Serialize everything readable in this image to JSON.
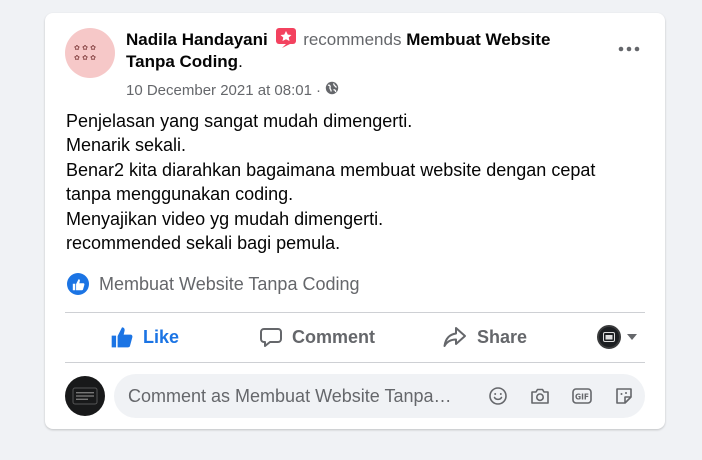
{
  "post": {
    "author": "Nadila Handayani",
    "verb": "recommends",
    "page_name": "Membuat Website Tanpa Coding",
    "timestamp": "10 December 2021 at 08:01",
    "separator": "·",
    "body_lines": [
      "Penjelasan yang sangat mudah dimengerti.",
      "Menarik sekali.",
      "Benar2 kita diarahkan bagaimana membuat website dengan cepat",
      "tanpa menggunakan coding.",
      "Menyajikan video yg mudah dimengerti.",
      "recommended sekali bagi pemula."
    ],
    "recommended_page": "Membuat Website Tanpa Coding"
  },
  "actions": {
    "like": "Like",
    "comment": "Comment",
    "share": "Share"
  },
  "comment_box": {
    "placeholder": "Comment as Membuat Website Tanpa…"
  },
  "colors": {
    "accent": "#1b74e4",
    "recommend_badge": "#f3425f",
    "muted_text": "#65676b"
  },
  "icons": {
    "recommend": "star-badge-icon",
    "privacy": "globe-icon",
    "more": "more-options-icon",
    "like": "thumbs-up-icon",
    "comment": "speech-bubble-icon",
    "share": "share-arrow-icon",
    "audience": "caret-down-icon",
    "emoji": "smiley-icon",
    "camera": "camera-icon",
    "gif": "gif-icon",
    "sticker": "sticker-icon"
  }
}
